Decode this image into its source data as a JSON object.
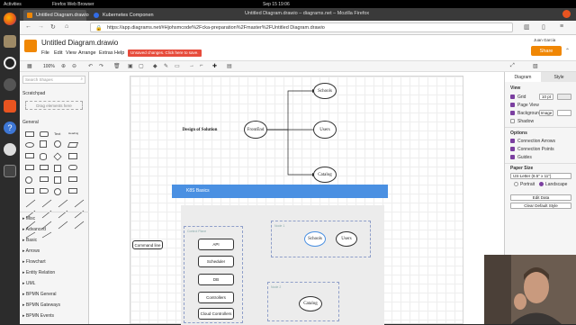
{
  "system": {
    "activities": "Activities",
    "app_name": "Firefox Web Browser",
    "clock": "Sep 15  19:06"
  },
  "browser": {
    "window_title": "Untitled Diagram.drawio – diagrams.net – Mozilla Firefox",
    "tabs": [
      {
        "label": "Untitled Diagram.drawio"
      },
      {
        "label": "Kubernetes Componen"
      }
    ],
    "url": "https://app.diagrams.net/#Hjohsmcode%2Fcka-preparation%2Fmaster%2FUntitled Diagram.drawio"
  },
  "drawio": {
    "doc_title": "Untitled Diagram.drawio",
    "menu": [
      "File",
      "Edit",
      "View",
      "Arrange",
      "Extras",
      "Help"
    ],
    "unsaved_notice": "Unsaved changes. Click here to save.",
    "user": "Juan Garcia",
    "share_label": "Share",
    "zoom": "100%",
    "accent": "#f08705"
  },
  "left_panel": {
    "search_placeholder": "Search Shapes",
    "scratchpad": "Scratchpad",
    "drag_hint": "Drag elements here",
    "general": "General",
    "categories": [
      "Misc",
      "Advanced",
      "Basic",
      "Arrows",
      "Flowchart",
      "Entity Relation",
      "UML",
      "BPMN General",
      "BPMN Gateways",
      "BPMN Events"
    ]
  },
  "diagram": {
    "design_title": "Design of Solution",
    "frontend": "FrontEnd",
    "schools": "Schools",
    "users": "Users",
    "catalog": "Catalog",
    "k8s_banner": "K8S Basics",
    "control_plane": "Control Plane",
    "command_line": "Command line",
    "api": "API",
    "scheduler": "Scheduler",
    "db": "DB",
    "controllers": "Controllers",
    "cloud_controllers": "Cloud Controllers",
    "node1": "Node 1",
    "node2": "Node 2",
    "node1_schools": "Schools",
    "node1_users": "Users",
    "node2_catalog": "Catalog",
    "banner_color": "#4a90e2"
  },
  "right_panel": {
    "tab_diagram": "Diagram",
    "tab_style": "Style",
    "view_heading": "View",
    "grid": "Grid",
    "grid_size": "10 pt",
    "page_view": "Page View",
    "background": "Background",
    "image_button": "Image",
    "shadow": "Shadow",
    "options_heading": "Options",
    "connection_arrows": "Connection Arrows",
    "connection_points": "Connection Points",
    "guides": "Guides",
    "paper_size_heading": "Paper Size",
    "paper_size_value": "US-Letter (8.5\" x 11\")",
    "portrait": "Portrait",
    "landscape": "Landscape",
    "edit_data": "Edit Data",
    "clear_default_style": "Clear Default Style"
  }
}
